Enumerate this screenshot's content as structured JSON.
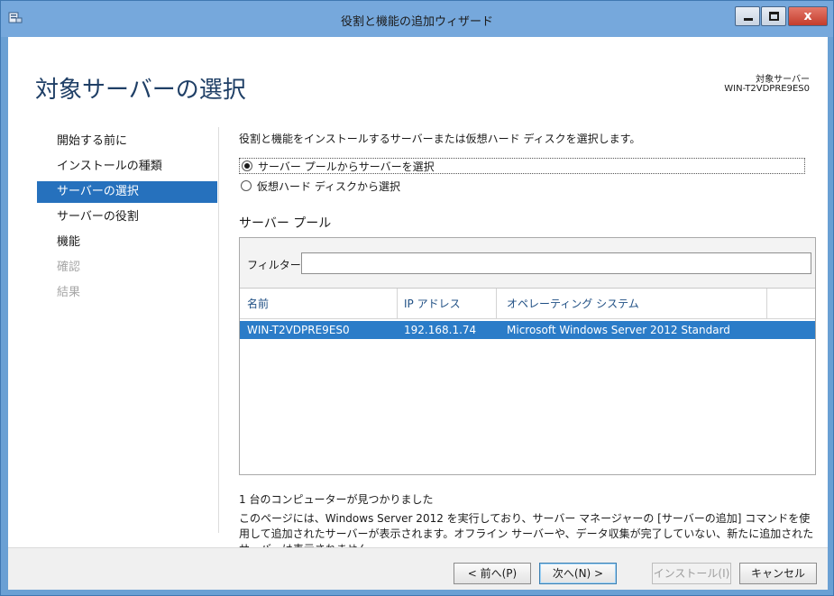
{
  "window": {
    "title": "役割と機能の追加ウィザード",
    "close_glyph": "x"
  },
  "header": {
    "page_title": "対象サーバーの選択",
    "target_server_label": "対象サーバー",
    "target_server_name": "WIN-T2VDPRE9ES0"
  },
  "nav": {
    "items": [
      {
        "label": "開始する前に",
        "state": "normal"
      },
      {
        "label": "インストールの種類",
        "state": "normal"
      },
      {
        "label": "サーバーの選択",
        "state": "active"
      },
      {
        "label": "サーバーの役割",
        "state": "normal"
      },
      {
        "label": "機能",
        "state": "normal"
      },
      {
        "label": "確認",
        "state": "disabled"
      },
      {
        "label": "結果",
        "state": "disabled"
      }
    ]
  },
  "main": {
    "description": "役割と機能をインストールするサーバーまたは仮想ハード ディスクを選択します。",
    "option_pool": "サーバー プールからサーバーを選択",
    "option_vhd": "仮想ハード ディスクから選択",
    "pool_title": "サーバー プール",
    "filter_label": "フィルター:",
    "filter_value": "",
    "columns": [
      "名前",
      "IP アドレス",
      "オペレーティング システム"
    ],
    "rows": [
      {
        "name": "WIN-T2VDPRE9ES0",
        "ip": "192.168.1.74",
        "os": "Microsoft Windows Server 2012 Standard"
      }
    ],
    "found_count": "1 台のコンピューターが見つかりました",
    "note": "このページには、Windows Server 2012 を実行しており、サーバー マネージャーの [サーバーの追加] コマンドを使用して追加されたサーバーが表示されます。オフライン サーバーや、データ収集が完了していない、新たに追加されたサーバーは表示されません。"
  },
  "footer": {
    "prev": "< 前へ(P)",
    "next": "次へ(N) >",
    "install": "インストール(I)",
    "cancel": "キャンセル"
  },
  "colors": {
    "titlebar": "#76a8dc",
    "nav_active": "#2671bd",
    "row_selected": "#2b7cc8",
    "close_button": "#c43c2c"
  }
}
